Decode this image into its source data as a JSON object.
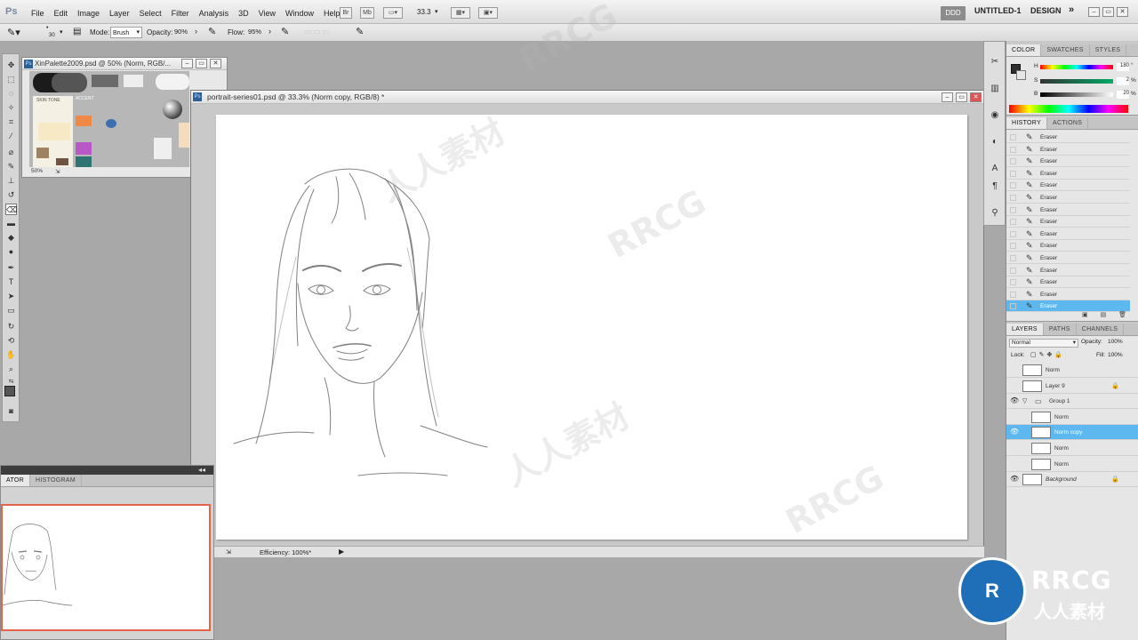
{
  "menubar": {
    "items": [
      "File",
      "Edit",
      "Image",
      "Layer",
      "Select",
      "Filter",
      "Analysis",
      "3D",
      "View",
      "Window",
      "Help"
    ],
    "zoom": "33.3",
    "badge_ddd": "DDD",
    "workspace1": "UNTITLED-1",
    "workspace2": "DESIGN",
    "more": "»"
  },
  "options": {
    "brush_size": "30",
    "mode_label": "Mode:",
    "mode_value": "Brush",
    "opacity_label": "Opacity:",
    "opacity_value": "90%",
    "flow_label": "Flow:",
    "flow_value": "95%"
  },
  "palette_doc": {
    "title": "XinPalette2009.psd @ 50% (Norm, RGB/...",
    "skin_tone": "SKIN TONE",
    "accent": "ACCENT",
    "zoom": "50%"
  },
  "main_doc": {
    "title": "portrait-series01.psd @ 33.3% (Norm copy, RGB/8) *",
    "status": "Efficiency: 100%*"
  },
  "navigator": {
    "tabs": [
      "ATOR",
      "HISTOGRAM"
    ]
  },
  "color_panel": {
    "tabs": [
      "COLOR",
      "SWATCHES",
      "STYLES"
    ],
    "channels": [
      {
        "label": "H",
        "value": "180",
        "unit": "°"
      },
      {
        "label": "S",
        "value": "2",
        "unit": "%"
      },
      {
        "label": "B",
        "value": "20",
        "unit": "%"
      }
    ]
  },
  "history_panel": {
    "tabs": [
      "HISTORY",
      "ACTIONS"
    ],
    "items": [
      "Eraser",
      "Eraser",
      "Eraser",
      "Eraser",
      "Eraser",
      "Eraser",
      "Eraser",
      "Eraser",
      "Eraser",
      "Eraser",
      "Eraser",
      "Eraser",
      "Eraser",
      "Eraser",
      "Eraser"
    ]
  },
  "layers_panel": {
    "tabs": [
      "LAYERS",
      "PATHS",
      "CHANNELS"
    ],
    "blend_mode": "Normal",
    "opacity_label": "Opacity:",
    "opacity_value": "100%",
    "lock_label": "Lock:",
    "fill_label": "Fill:",
    "fill_value": "100%",
    "layers": [
      {
        "name": "Norm",
        "visible": false
      },
      {
        "name": "Layer 9",
        "visible": false
      },
      {
        "name": "Group 1",
        "visible": true
      },
      {
        "name": "Norm",
        "visible": false
      },
      {
        "name": "Norm copy",
        "visible": true
      },
      {
        "name": "Norm",
        "visible": false
      },
      {
        "name": "Norm",
        "visible": false
      },
      {
        "name": "Background",
        "visible": true
      }
    ]
  },
  "watermark": {
    "text_latin": "RRCG",
    "text_cn": "人人素材"
  }
}
